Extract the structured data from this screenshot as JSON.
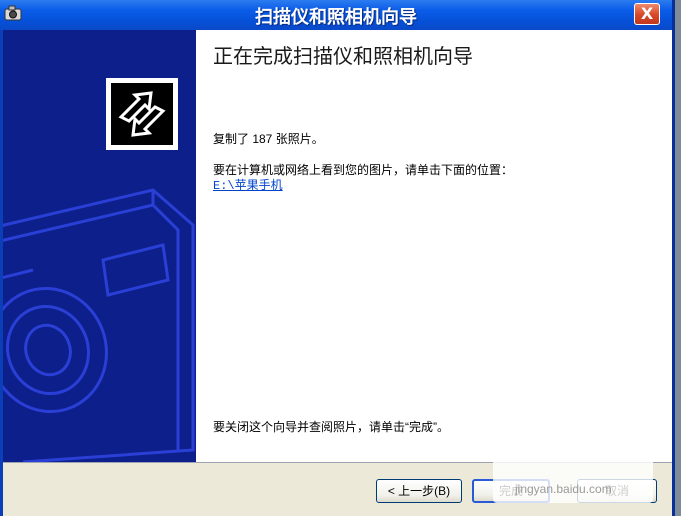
{
  "window": {
    "title": "扫描仪和照相机向导",
    "close_label": "X"
  },
  "content": {
    "heading": "正在完成扫描仪和照相机向导",
    "copied_text": "复制了 187 张照片。",
    "view_prompt": "要在计算机或网络上看到您的图片，请单击下面的位置：",
    "location_link": "E:\\苹果手机",
    "close_prompt": "要关闭这个向导并查阅照片，请单击“完成”。"
  },
  "footer": {
    "back_label": "< 上一步(B)",
    "finish_label": "完成",
    "cancel_label": "取消"
  },
  "watermark": "jingyan.baidu.com",
  "colors": {
    "titlebar": "#0a5ce8",
    "left_panel": "#0c1f8a",
    "camera_lines": "#2a3fd6",
    "close_button": "#d8472a"
  }
}
